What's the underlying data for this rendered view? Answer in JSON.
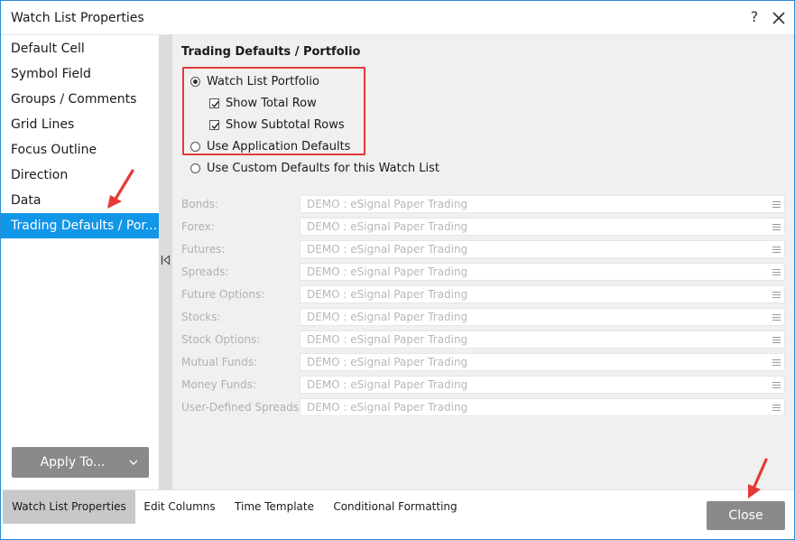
{
  "window": {
    "title": "Watch List Properties",
    "help_label": "?"
  },
  "sidebar": {
    "items": [
      {
        "label": "Default Cell"
      },
      {
        "label": "Symbol Field"
      },
      {
        "label": "Groups / Comments"
      },
      {
        "label": "Grid Lines"
      },
      {
        "label": "Focus Outline"
      },
      {
        "label": "Direction"
      },
      {
        "label": "Data"
      },
      {
        "label": "Trading Defaults / Por..."
      }
    ],
    "active_index": 7,
    "apply_label": "Apply To..."
  },
  "content": {
    "section_title": "Trading Defaults / Portfolio",
    "options": {
      "watch_list_portfolio": "Watch List Portfolio",
      "show_total_row": "Show Total Row",
      "show_subtotal_rows": "Show Subtotal Rows",
      "use_app_defaults": "Use Application Defaults",
      "use_custom_defaults": "Use Custom Defaults for this Watch List"
    },
    "rows": [
      {
        "label": "Bonds:",
        "value": "DEMO : eSignal Paper Trading"
      },
      {
        "label": "Forex:",
        "value": "DEMO : eSignal Paper Trading"
      },
      {
        "label": "Futures:",
        "value": "DEMO : eSignal Paper Trading"
      },
      {
        "label": "Spreads:",
        "value": "DEMO : eSignal Paper Trading"
      },
      {
        "label": "Future Options:",
        "value": "DEMO : eSignal Paper Trading"
      },
      {
        "label": "Stocks:",
        "value": "DEMO : eSignal Paper Trading"
      },
      {
        "label": "Stock Options:",
        "value": "DEMO : eSignal Paper Trading"
      },
      {
        "label": "Mutual Funds:",
        "value": "DEMO : eSignal Paper Trading"
      },
      {
        "label": "Money Funds:",
        "value": "DEMO : eSignal Paper Trading"
      },
      {
        "label": "User-Defined Spreads:",
        "value": "DEMO : eSignal Paper Trading"
      }
    ]
  },
  "bottom": {
    "tabs": [
      {
        "label": "Watch List Properties"
      },
      {
        "label": "Edit Columns"
      },
      {
        "label": "Time Template"
      },
      {
        "label": "Conditional Formatting"
      }
    ],
    "close_label": "Close"
  },
  "colors": {
    "accent": "#1296e8",
    "annotation": "#e53935",
    "button_gray": "#8a8a8a"
  }
}
